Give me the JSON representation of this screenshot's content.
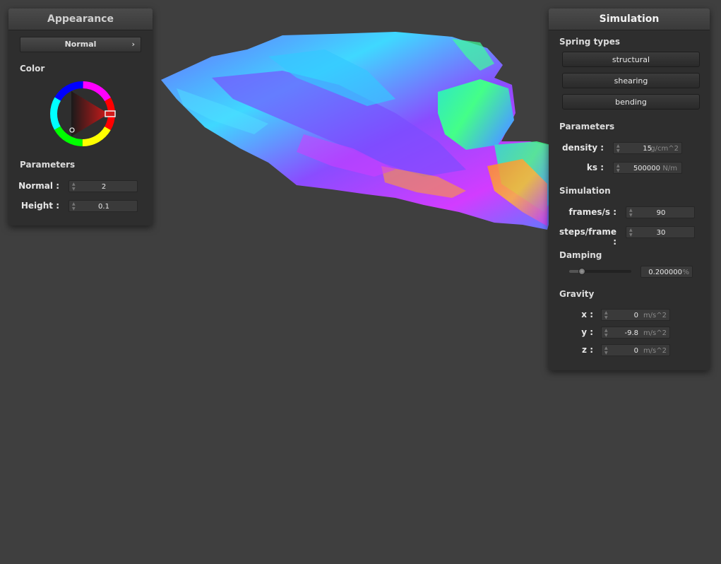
{
  "appearance": {
    "title": "Appearance",
    "shader_combo": "Normal",
    "chevron": "›",
    "color_label": "Color",
    "color_selected": "#d11a1a",
    "parameters_label": "Parameters",
    "normal_label": "Normal :",
    "normal_value": "2",
    "height_label": "Height :",
    "height_value": "0.1"
  },
  "simulation": {
    "title": "Simulation",
    "spring_types_label": "Spring types",
    "structural_button": "structural",
    "shearing_button": "shearing",
    "bending_button": "bending",
    "parameters_label": "Parameters",
    "density_label": "density :",
    "density_value": "15",
    "density_unit": "g/cm^2",
    "ks_label": "ks :",
    "ks_value": "500000",
    "ks_unit": "N/m",
    "simulation_label": "Simulation",
    "fps_label": "frames/s :",
    "fps_value": "90",
    "steps_label": "steps/frame :",
    "steps_value": "30",
    "damping_label": "Damping",
    "damping_value": "0.200000",
    "damping_unit": "%",
    "damping_level": 0.2,
    "gravity_label": "Gravity",
    "gx_label": "x :",
    "gx_value": "0",
    "gy_label": "y :",
    "gy_value": "-9.8",
    "gz_label": "z :",
    "gz_value": "0",
    "gravity_unit": "m/s^2"
  },
  "icons": {
    "spinner": "spinner-icon",
    "chevron": "chevron-right-icon"
  }
}
